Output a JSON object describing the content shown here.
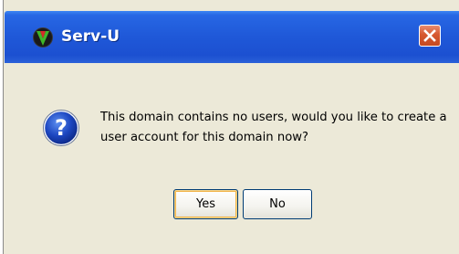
{
  "window": {
    "title": "Serv-U",
    "close_label": "Close"
  },
  "dialog": {
    "message": "This domain contains no users, would you like to create a user account for this domain now?",
    "icon": "question-icon"
  },
  "buttons": {
    "yes_label": "Yes",
    "no_label": "No"
  },
  "colors": {
    "titlebar": "#1f58d8",
    "dialog_background": "#ece9d8",
    "close_button": "#d6582f",
    "question_icon": "#1a3fa8"
  }
}
